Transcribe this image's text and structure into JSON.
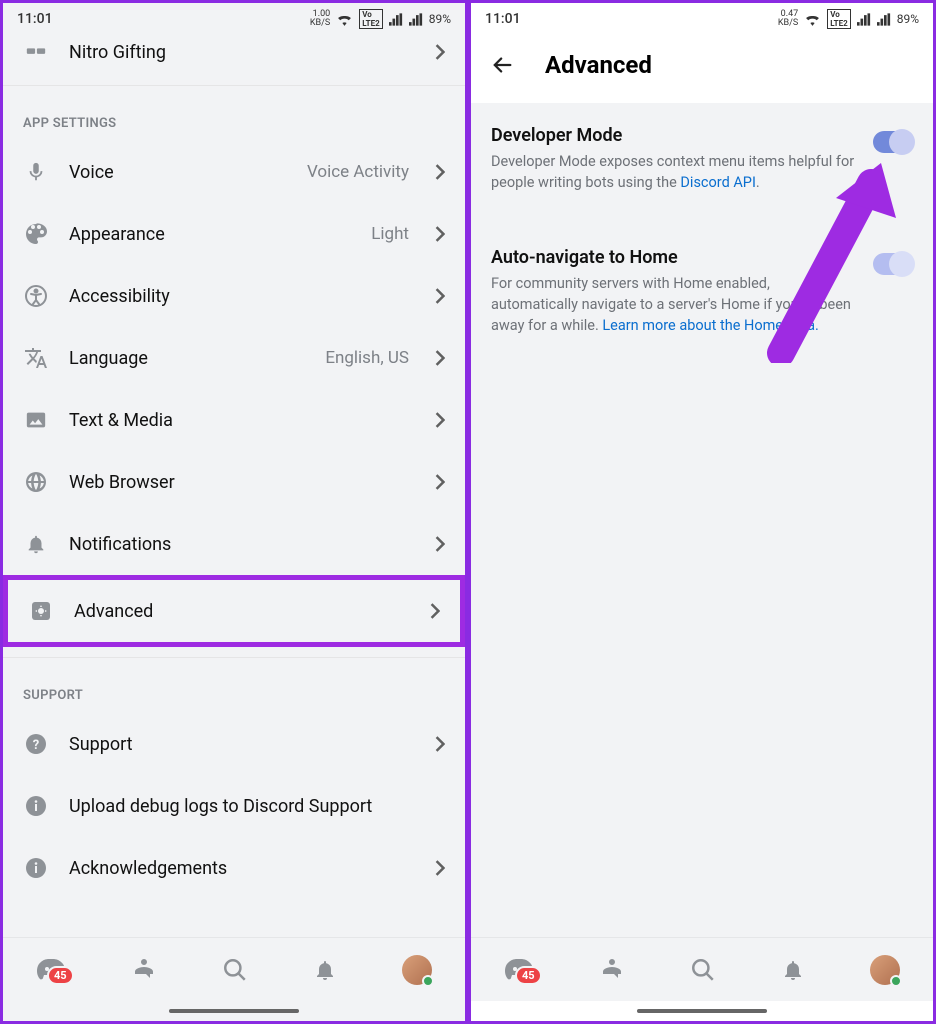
{
  "left": {
    "status": {
      "time": "11:01",
      "kbs_top": "1.00",
      "kbs_bottom": "KB/S",
      "battery": "89%"
    },
    "partial_row": {
      "label": "Nitro Gifting"
    },
    "section1": "APP SETTINGS",
    "rows": [
      {
        "label": "Voice",
        "value": "Voice Activity"
      },
      {
        "label": "Appearance",
        "value": "Light"
      },
      {
        "label": "Accessibility",
        "value": ""
      },
      {
        "label": "Language",
        "value": "English, US"
      },
      {
        "label": "Text & Media",
        "value": ""
      },
      {
        "label": "Web Browser",
        "value": ""
      },
      {
        "label": "Notifications",
        "value": ""
      }
    ],
    "advanced": {
      "label": "Advanced"
    },
    "section2": "SUPPORT",
    "support_rows": [
      {
        "label": "Support"
      },
      {
        "label": "Upload debug logs to Discord Support"
      },
      {
        "label": "Acknowledgements"
      }
    ],
    "badge": "45"
  },
  "right": {
    "status": {
      "time": "11:01",
      "kbs_top": "0.47",
      "kbs_bottom": "KB/S",
      "battery": "89%"
    },
    "title": "Advanced",
    "dev": {
      "title": "Developer Mode",
      "desc": "Developer Mode exposes context menu items helpful for people writing bots using the ",
      "link": "Discord API"
    },
    "auto": {
      "title": "Auto-navigate to Home",
      "desc": "For community servers with Home enabled, automatically navigate to a server's Home if you've been away for a while. ",
      "link": "Learn more about the Home beta."
    },
    "badge": "45"
  }
}
